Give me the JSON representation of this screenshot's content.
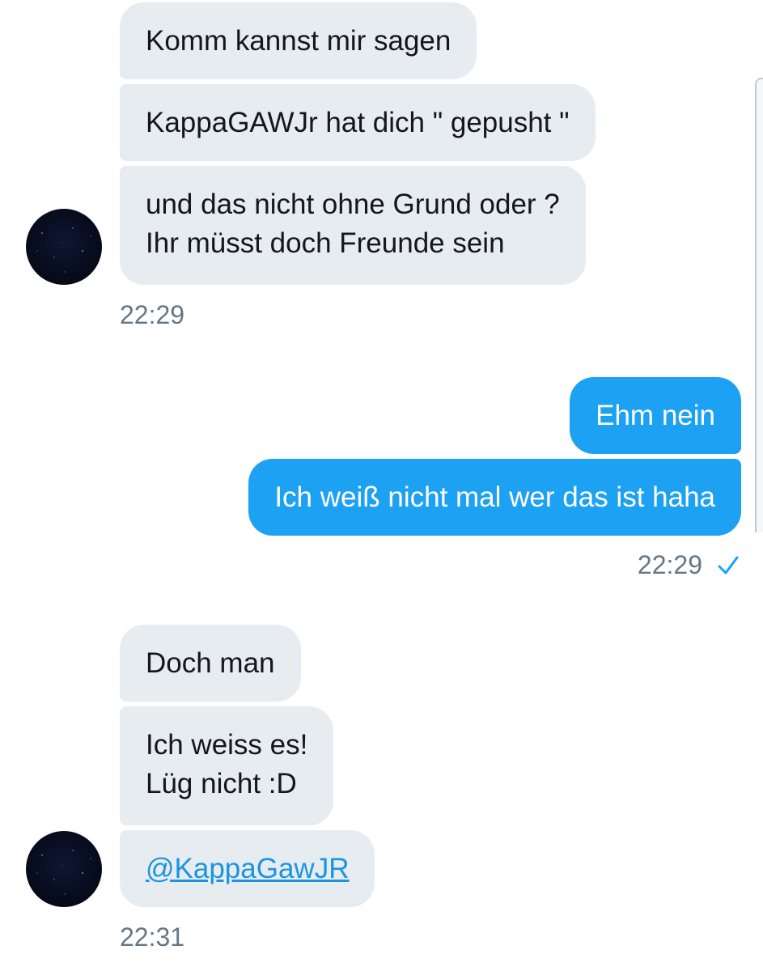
{
  "conversation": {
    "groups": [
      {
        "sender": "them",
        "messages": [
          {
            "lines": [
              "Komm kannst mir sagen"
            ]
          },
          {
            "lines": [
              "KappaGAWJr hat dich \" gepusht \""
            ]
          },
          {
            "lines": [
              "und das nicht ohne Grund oder ?",
              "Ihr müsst doch Freunde sein"
            ]
          }
        ],
        "time": "22:29"
      },
      {
        "sender": "me",
        "messages": [
          {
            "lines": [
              "Ehm nein"
            ]
          },
          {
            "lines": [
              "Ich weiß nicht mal wer das ist haha"
            ]
          }
        ],
        "time": "22:29",
        "status_icon": "checkmark-icon"
      },
      {
        "sender": "them",
        "messages": [
          {
            "lines": [
              "Doch man"
            ]
          },
          {
            "lines": [
              "Ich weiss es!",
              "Lüg nicht :D"
            ]
          },
          {
            "lines": [
              "@KappaGawJR"
            ]
          }
        ],
        "time": "22:31"
      }
    ]
  },
  "colors": {
    "incoming_bubble": "#e6ecf0",
    "outgoing_bubble": "#1da1f2",
    "timestamp": "#657786",
    "mention": "#1b95e0"
  }
}
